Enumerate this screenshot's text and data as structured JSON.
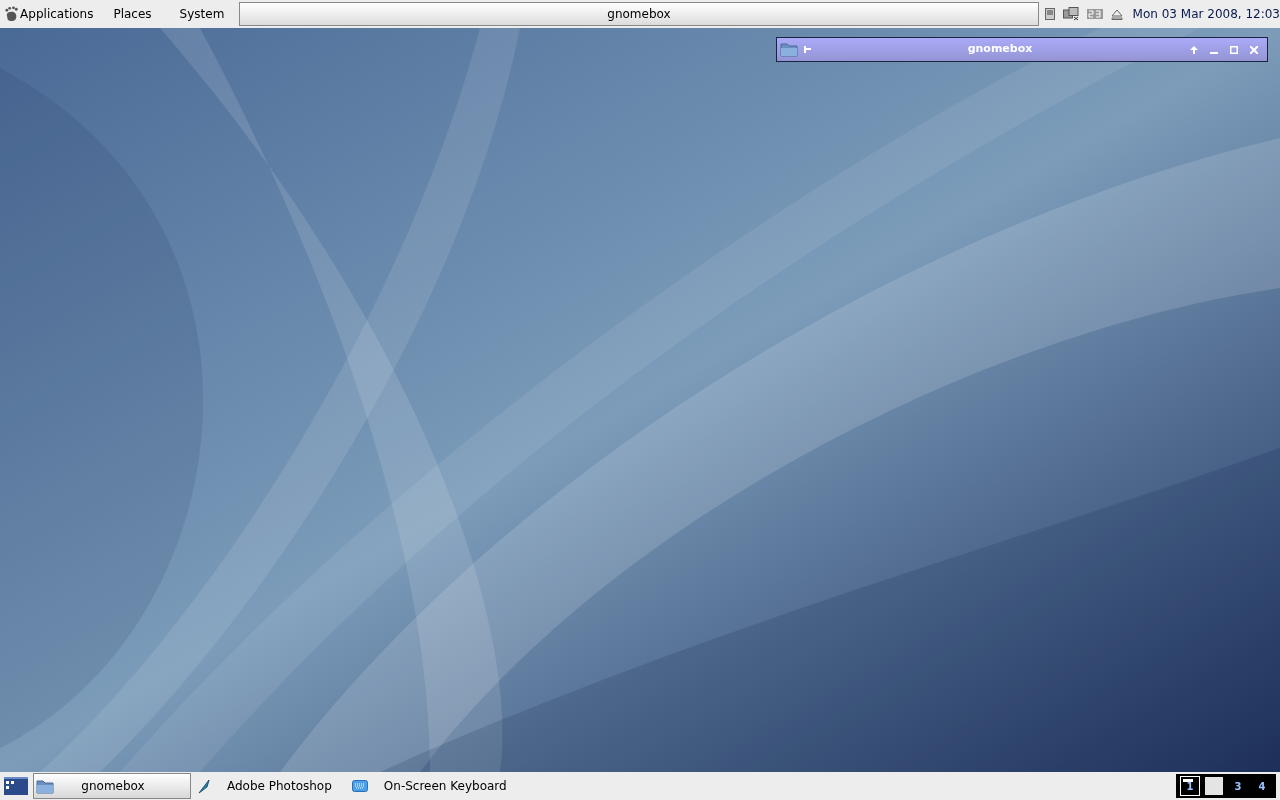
{
  "top_panel": {
    "menus": [
      {
        "label": "Applications"
      },
      {
        "label": "Places"
      },
      {
        "label": "System"
      }
    ],
    "active_window_title": "gnomebox",
    "clock": "Mon 03 Mar 2008, 12:03"
  },
  "shaded_window": {
    "title": "gnomebox"
  },
  "bottom_panel": {
    "tasks": [
      {
        "label": "gnomebox",
        "kind": "folder",
        "selected": true
      },
      {
        "label": "Adobe Photoshop",
        "kind": "feather",
        "selected": false
      },
      {
        "label": "On-Screen Keyboard",
        "kind": "keyboard",
        "selected": false
      }
    ],
    "workspaces": [
      {
        "label": "1",
        "selected": true,
        "kind": "window"
      },
      {
        "selected": false,
        "kind": "filled"
      },
      {
        "label": "3",
        "selected": false,
        "kind": "empty"
      },
      {
        "label": "4",
        "selected": false,
        "kind": "empty"
      }
    ]
  }
}
